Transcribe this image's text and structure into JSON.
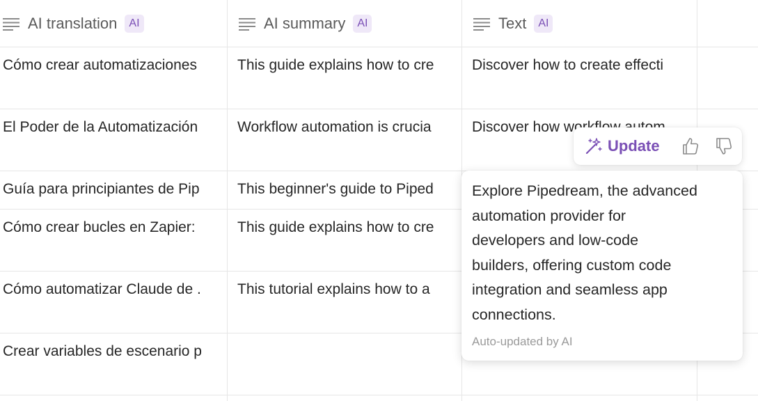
{
  "columns": [
    {
      "label": "AI translation",
      "badge": "AI",
      "icon": "text-lines-icon"
    },
    {
      "label": "AI summary",
      "badge": "AI",
      "icon": "text-lines-icon"
    },
    {
      "label": "Text",
      "badge": "AI",
      "icon": "text-lines-icon"
    }
  ],
  "rows": [
    {
      "translation": "Cómo crear automatizaciones",
      "summary": "This guide explains how to cre",
      "text": "Discover how to create effecti"
    },
    {
      "translation": "El Poder de la Automatización",
      "summary": "Workflow automation is crucia",
      "text": "Discover how workflow autom"
    },
    {
      "translation": "Guía para principiantes de Pip",
      "summary": "This beginner's guide to Piped",
      "text": ""
    },
    {
      "translation": "Cómo crear bucles en Zapier:",
      "summary": "This guide explains how to cre",
      "text": ""
    },
    {
      "translation": "Cómo automatizar Claude de .",
      "summary": "This tutorial explains how to a",
      "text": ""
    },
    {
      "translation": "Crear variables de escenario p",
      "summary": "",
      "text": ""
    }
  ],
  "action_bar": {
    "update_label": "Update",
    "update_icon": "magic-wand-icon",
    "like_icon": "thumbs-up-icon",
    "dislike_icon": "thumbs-down-icon"
  },
  "popover": {
    "body": "Explore Pipedream, the advanced\nautomation provider for\ndevelopers and low-code\nbuilders, offering custom code\nintegration and seamless app\nconnections.",
    "footer": "Auto-updated by AI"
  },
  "colors": {
    "accent": "#7a4fb5",
    "badge_bg": "#efe8f8",
    "grid_line": "#e6e6e6"
  }
}
